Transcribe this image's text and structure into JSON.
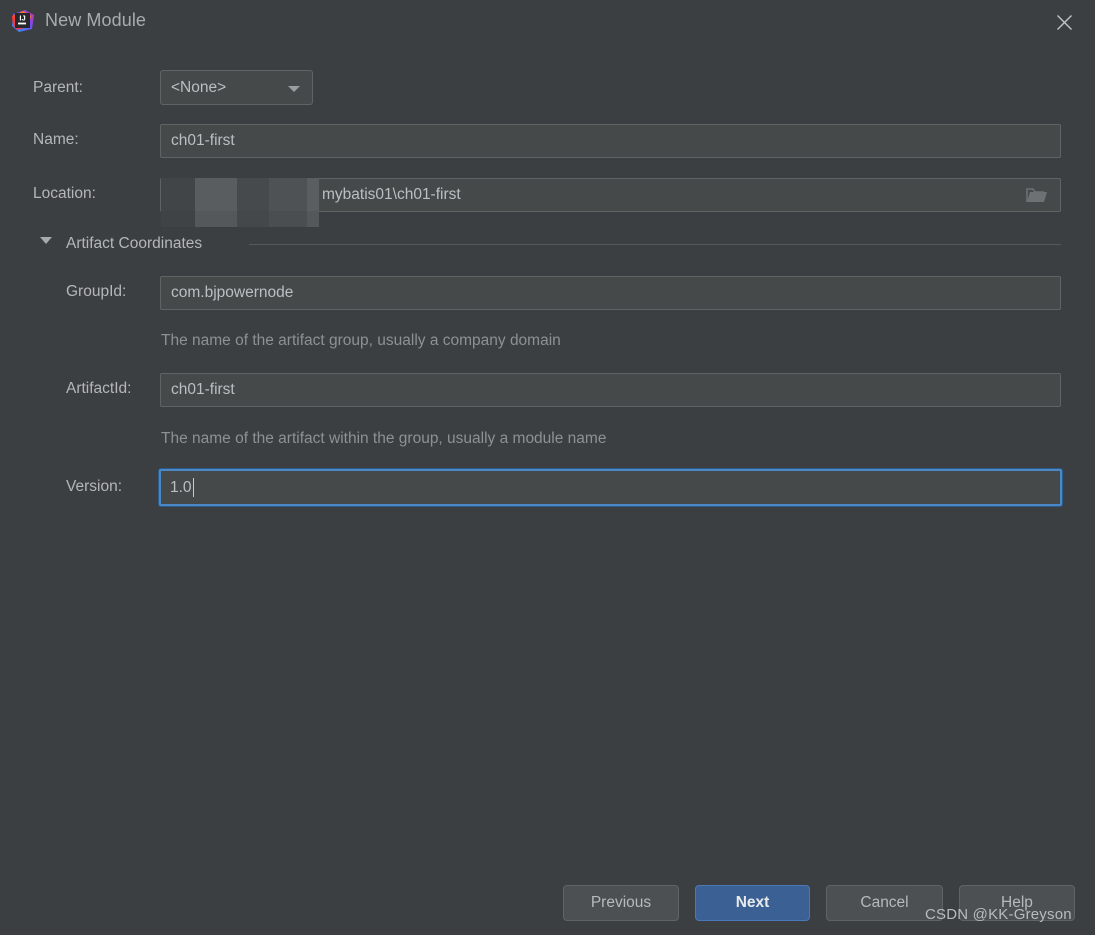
{
  "window": {
    "title": "New Module",
    "app_icon": "intellij-idea-logo-icon",
    "close_icon": "close-icon"
  },
  "form": {
    "parent": {
      "label": "Parent:",
      "value": "<None>",
      "dropdown_icon": "chevron-down-icon"
    },
    "name": {
      "label": "Name:",
      "value": "ch01-first"
    },
    "location": {
      "label": "Location:",
      "value": "mybatis01\\ch01-first",
      "censored": true,
      "browse_icon": "folder-icon"
    }
  },
  "artifact_section": {
    "title": "Artifact Coordinates",
    "toggle_icon": "chevron-down-icon",
    "expanded": true,
    "group_id": {
      "label": "GroupId:",
      "value": "com.bjpowernode",
      "hint": "The name of the artifact group, usually a company domain"
    },
    "artifact_id": {
      "label": "ArtifactId:",
      "value": "ch01-first",
      "hint": "The name of the artifact within the group, usually a module name"
    },
    "version": {
      "label": "Version:",
      "value": "1.0",
      "focused": true
    }
  },
  "buttons": {
    "previous": "Previous",
    "next": "Next",
    "cancel": "Cancel",
    "help": "Help"
  },
  "watermark": "CSDN @KK-Greyson",
  "colors": {
    "background": "#3c3f41",
    "field_background": "#45494a",
    "field_border": "#5e6364",
    "accent_focus": "#4a88c7",
    "primary_button": "#3b6094",
    "text": "#b4b7b9",
    "hint_text": "#8d9193"
  }
}
